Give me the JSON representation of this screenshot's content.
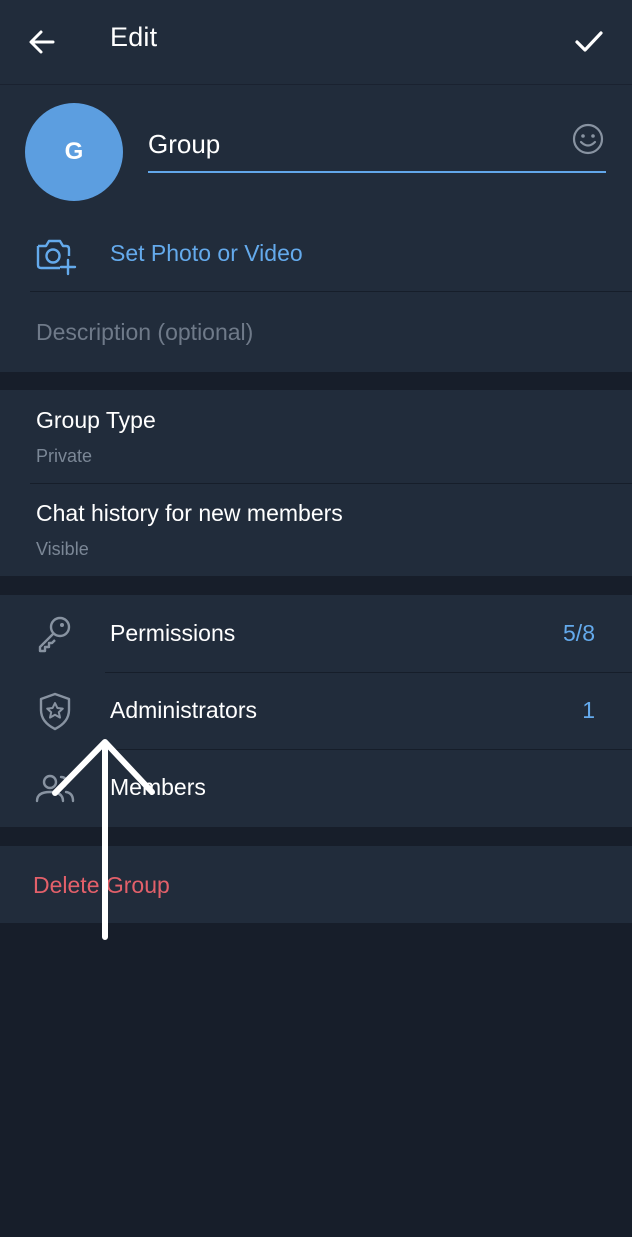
{
  "header": {
    "title": "Edit",
    "back_icon": "arrow-left-icon",
    "confirm_icon": "check-icon"
  },
  "profile": {
    "avatar_letter": "G",
    "avatar_color": "#5c9ee0",
    "name_value": "Group",
    "emoji_icon": "smile-icon",
    "set_photo_label": "Set Photo or Video",
    "description_placeholder": "Description (optional)"
  },
  "settings": [
    {
      "title": "Group Type",
      "value": "Private"
    },
    {
      "title": "Chat history for new members",
      "value": "Visible"
    }
  ],
  "manage": [
    {
      "label": "Permissions",
      "count": "5/8",
      "icon": "key-icon"
    },
    {
      "label": "Administrators",
      "count": "1",
      "icon": "shield-star-icon"
    },
    {
      "label": "Members",
      "count": "",
      "icon": "users-icon"
    }
  ],
  "danger": {
    "delete_label": "Delete Group"
  },
  "colors": {
    "background": "#171e2a",
    "card": "#212c3b",
    "accent": "#64aaec",
    "danger": "#e3606a"
  }
}
